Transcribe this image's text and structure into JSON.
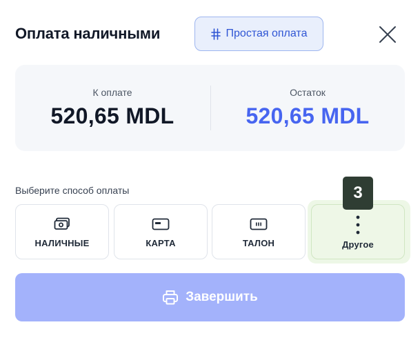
{
  "header": {
    "title": "Оплата наличными",
    "mode_button_label": "Простая оплата",
    "mode_icon": "sliders-icon",
    "close_icon": "close-icon"
  },
  "summary": {
    "to_pay_label": "К оплате",
    "to_pay_amount": "520,65 MDL",
    "remaining_label": "Остаток",
    "remaining_amount": "520,65 MDL"
  },
  "methods": {
    "label": "Выберите способ оплаты",
    "items": [
      {
        "label": "НАЛИЧНЫЕ",
        "icon": "cash-icon"
      },
      {
        "label": "КАРТА",
        "icon": "card-icon"
      },
      {
        "label": "ТАЛОН",
        "icon": "voucher-icon"
      },
      {
        "label": "Другое",
        "icon": "more-vertical-icon"
      }
    ]
  },
  "badge": "3",
  "finish": {
    "label": "Завершить",
    "icon": "printer-icon"
  },
  "colors": {
    "accent": "#4765f0",
    "mode_button_bg": "#e9effc",
    "finish_button_bg": "#a3b2fb",
    "highlight_bg": "#edf7e6",
    "badge_bg": "#2f3d33"
  }
}
